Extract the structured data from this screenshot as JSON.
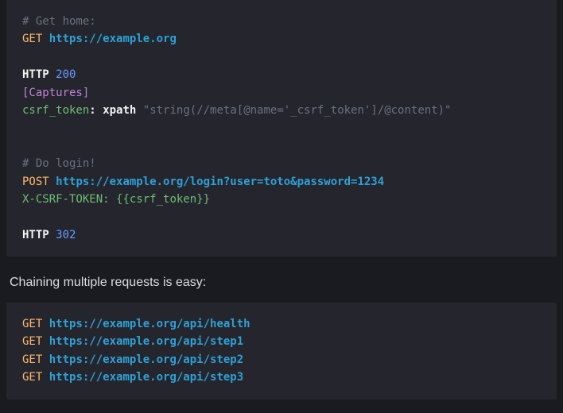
{
  "block1": {
    "c1": "# Get home:",
    "m1": "GET",
    "u1": "https://example.org",
    "kw1": "HTTP",
    "code1": "200",
    "sec1": "[Captures]",
    "cap_name": "csrf_token",
    "cap_colon": ":",
    "cap_fn": "xpath",
    "cap_arg": "\"string(//meta[@name='_csrf_token']/@content)\"",
    "c2": "# Do login!",
    "m2": "POST",
    "u2": "https://example.org/login?user=toto&password=1234",
    "hdr_name": "X-CSRF-TOKEN:",
    "hdr_val": "{{csrf_token}}",
    "kw2": "HTTP",
    "code2": "302"
  },
  "prose1": "Chaining multiple requests is easy:",
  "block2": {
    "lines": [
      {
        "m": "GET",
        "u": "https://example.org/api/health"
      },
      {
        "m": "GET",
        "u": "https://example.org/api/step1"
      },
      {
        "m": "GET",
        "u": "https://example.org/api/step2"
      },
      {
        "m": "GET",
        "u": "https://example.org/api/step3"
      }
    ]
  }
}
